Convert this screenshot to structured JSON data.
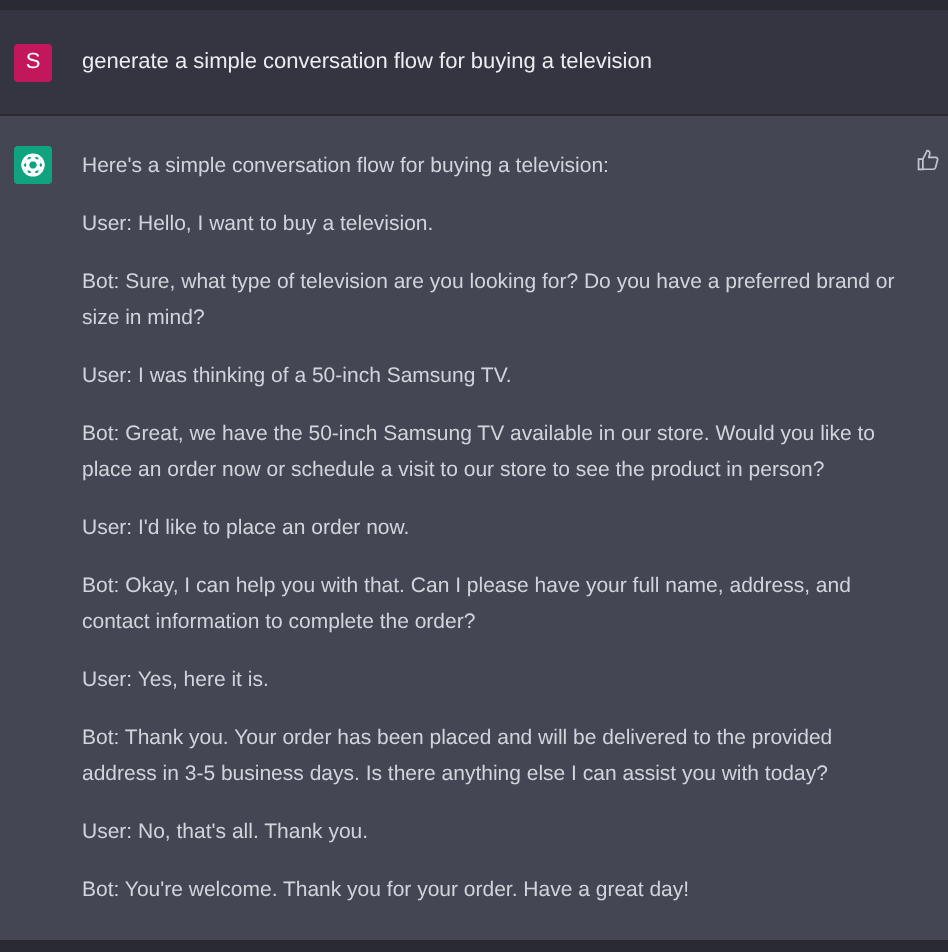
{
  "prompt": {
    "avatar": "S",
    "text": "generate a simple conversation flow for buying a television"
  },
  "response": {
    "paragraphs": [
      "Here's a simple conversation flow for buying a television:",
      "User: Hello, I want to buy a television.",
      "Bot: Sure, what type of television are you looking for? Do you have a preferred brand or size in mind?",
      "User: I was thinking of a 50-inch Samsung TV.",
      "Bot: Great, we have the 50-inch Samsung TV available in our store. Would you like to place an order now or schedule a visit to our store to see the product in person?",
      "User: I'd like to place an order now.",
      "Bot: Okay, I can help you with that. Can I please have your full name, address, and contact information to complete the order?",
      "User: Yes, here it is.",
      "Bot: Thank you. Your order has been placed and will be delivered to the provided address in 3-5 business days. Is there anything else I can assist you with today?",
      "User: No, that's all. Thank you.",
      "Bot: You're welcome. Thank you for your order. Have a great day!"
    ]
  }
}
